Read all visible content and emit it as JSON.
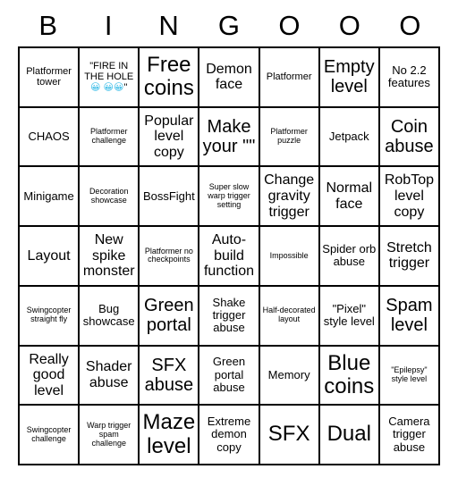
{
  "header": {
    "letters": [
      "B",
      "I",
      "N",
      "G",
      "O",
      "O",
      "O"
    ]
  },
  "grid": {
    "columns": 7,
    "rows": 7,
    "cells": [
      {
        "text": "Platformer tower",
        "size": "fs-s"
      },
      {
        "text": "\"FIRE IN THE HOLE😀 😀😀\"",
        "size": "fs-s"
      },
      {
        "text": "Free coins",
        "size": "fs-xxl"
      },
      {
        "text": "Demon face",
        "size": "fs-l"
      },
      {
        "text": "Platformer",
        "size": "fs-s"
      },
      {
        "text": "Empty level",
        "size": "fs-xl"
      },
      {
        "text": "No 2.2 features",
        "size": "fs-m"
      },
      {
        "text": "CHAOS",
        "size": "fs-m"
      },
      {
        "text": "Platformer challenge",
        "size": "fs-xs"
      },
      {
        "text": "Popular level copy",
        "size": "fs-l"
      },
      {
        "text": "Make your \"\"",
        "size": "fs-xl"
      },
      {
        "text": "Platformer puzzle",
        "size": "fs-xs"
      },
      {
        "text": "Jetpack",
        "size": "fs-m"
      },
      {
        "text": "Coin abuse",
        "size": "fs-xl"
      },
      {
        "text": "Minigame",
        "size": "fs-m"
      },
      {
        "text": "Decoration showcase",
        "size": "fs-xs"
      },
      {
        "text": "BossFight",
        "size": "fs-m"
      },
      {
        "text": "Super slow warp trigger setting",
        "size": "fs-xs"
      },
      {
        "text": "Change gravity trigger",
        "size": "fs-l"
      },
      {
        "text": "Normal face",
        "size": "fs-l"
      },
      {
        "text": "RobTop level copy",
        "size": "fs-l"
      },
      {
        "text": "Layout",
        "size": "fs-l"
      },
      {
        "text": "New spike monster",
        "size": "fs-l"
      },
      {
        "text": "Platformer no checkpoints",
        "size": "fs-xs"
      },
      {
        "text": "Auto-build function",
        "size": "fs-l"
      },
      {
        "text": "Impossible",
        "size": "fs-xs"
      },
      {
        "text": "Spider orb abuse",
        "size": "fs-m"
      },
      {
        "text": "Stretch trigger",
        "size": "fs-l"
      },
      {
        "text": "Swingcopter straight fly",
        "size": "fs-xs"
      },
      {
        "text": "Bug showcase",
        "size": "fs-m"
      },
      {
        "text": "Green portal",
        "size": "fs-xl"
      },
      {
        "text": "Shake trigger abuse",
        "size": "fs-m"
      },
      {
        "text": "Half-decorated layout",
        "size": "fs-xs"
      },
      {
        "text": "\"Pixel\" style level",
        "size": "fs-m"
      },
      {
        "text": "Spam level",
        "size": "fs-xl"
      },
      {
        "text": "Really good level",
        "size": "fs-l"
      },
      {
        "text": "Shader abuse",
        "size": "fs-l"
      },
      {
        "text": "SFX abuse",
        "size": "fs-xl"
      },
      {
        "text": "Green portal abuse",
        "size": "fs-m"
      },
      {
        "text": "Memory",
        "size": "fs-m"
      },
      {
        "text": "Blue coins",
        "size": "fs-xxl"
      },
      {
        "text": "\"Epilepsy\" style level",
        "size": "fs-xs"
      },
      {
        "text": "Swingcopter challenge",
        "size": "fs-xs"
      },
      {
        "text": "Warp trigger spam challenge",
        "size": "fs-xs"
      },
      {
        "text": "Maze level",
        "size": "fs-xxl"
      },
      {
        "text": "Extreme demon copy",
        "size": "fs-m"
      },
      {
        "text": "SFX",
        "size": "fs-xxl"
      },
      {
        "text": "Dual",
        "size": "fs-xxl"
      },
      {
        "text": "Camera trigger abuse",
        "size": "fs-m"
      }
    ]
  }
}
